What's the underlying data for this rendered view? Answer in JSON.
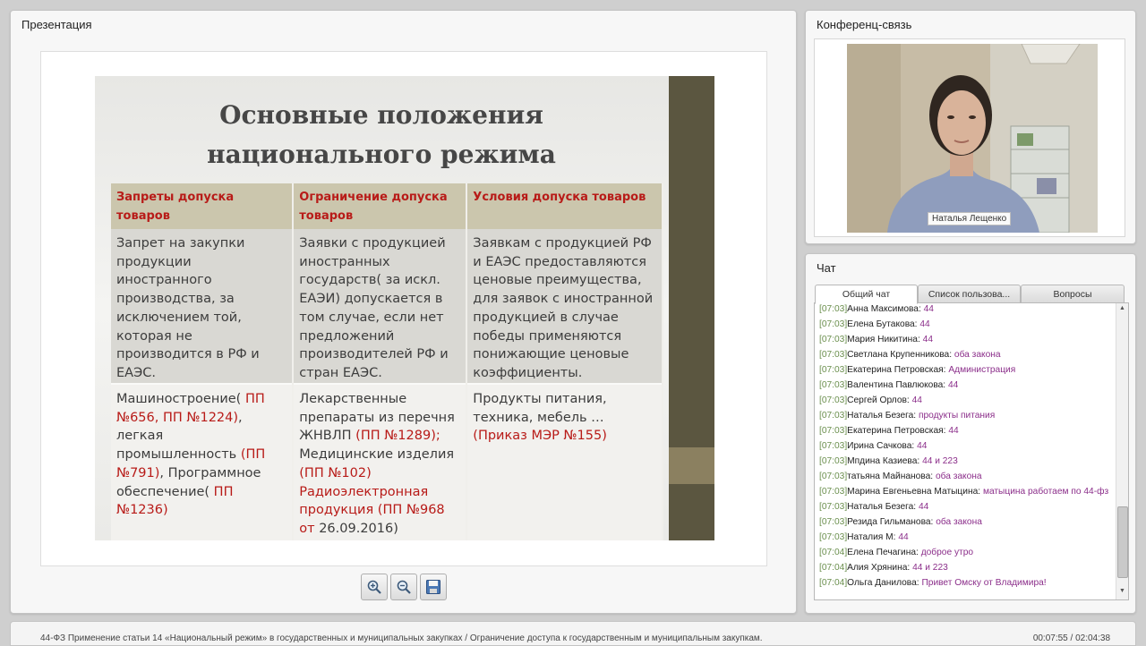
{
  "presentation": {
    "panel_title": "Презентация",
    "slide": {
      "title_line1": "Основные положения",
      "title_line2": "национального режима",
      "headers": [
        "Запреты допуска товаров",
        "Ограничение допуска товаров",
        "Условия допуска товаров"
      ],
      "row1": [
        "Запрет на закупки продукции иностранного производства, за исключением той, которая не производится в РФ и ЕАЭС.",
        "Заявки с продукцией иностранных государств( за искл. ЕАЭИ) допускается в том случае, если нет предложений производителей РФ и стран ЕАЭС.",
        "Заявкам с продукцией РФ и ЕАЭС предоставляются ценовые преимущества, для заявок с иностранной продукцией в случае победы применяются понижающие ценовые коэффициенты."
      ],
      "row2": {
        "c1_a": "Машиностроение(",
        "c1_b": " ПП №656, ПП №1224)",
        "c1_c": ", легкая промышленность ",
        "c1_d": "(ПП №791)",
        "c1_e": ", Программное обеспечение(",
        "c1_f": " ПП №1236)",
        "c2_a": "Лекарственные препараты из перечня ЖНВЛП ",
        "c2_b": "(ПП №1289);",
        "c2_c": " Медицинские изделия ",
        "c2_d": "(ПП №102) Радиоэлектронная продукция (ПП №968 от ",
        "c2_e": "26.09.2016)",
        "c3_a": "Продукты питания, техника, мебель … ",
        "c3_b": "(Приказ МЭР №155)"
      }
    },
    "tools": [
      "zoom-in",
      "zoom-out",
      "save"
    ]
  },
  "conference": {
    "panel_title": "Конференц-связь",
    "speaker_name": "Наталья Лещенко"
  },
  "chat": {
    "panel_title": "Чат",
    "tabs": [
      "Общий чат",
      "Список пользова...",
      "Вопросы"
    ],
    "messages": [
      {
        "time": "[07:03]",
        "name": "Анна Максимова:",
        "text": "44"
      },
      {
        "time": "[07:03]",
        "name": "Елена Бутакова:",
        "text": "44"
      },
      {
        "time": "[07:03]",
        "name": "Мария Никитина:",
        "text": "44"
      },
      {
        "time": "[07:03]",
        "name": "Светлана Крупенникова:",
        "text": "оба закона"
      },
      {
        "time": "[07:03]",
        "name": "Екатерина Петровская:",
        "text": "Администрация"
      },
      {
        "time": "[07:03]",
        "name": "Валентина Павлюкова:",
        "text": "44"
      },
      {
        "time": "[07:03]",
        "name": "Сергей Орлов:",
        "text": "44"
      },
      {
        "time": "[07:03]",
        "name": "Наталья Безега:",
        "text": "продукты питания"
      },
      {
        "time": "[07:03]",
        "name": "Екатерина Петровская:",
        "text": "44"
      },
      {
        "time": "[07:03]",
        "name": "Ирина Сачкова:",
        "text": "44"
      },
      {
        "time": "[07:03]",
        "name": "Мпдина Казиева:",
        "text": "44 и 223"
      },
      {
        "time": "[07:03]",
        "name": "татьяна Майнанова:",
        "text": "оба закона"
      },
      {
        "time": "[07:03]",
        "name": "Марина Евгеньевна Матыцина:",
        "text": "матыцина работаем по 44-фз"
      },
      {
        "time": "[07:03]",
        "name": "Наталья Безега:",
        "text": "44"
      },
      {
        "time": "[07:03]",
        "name": "Резида Гильманова:",
        "text": "оба закона"
      },
      {
        "time": "[07:03]",
        "name": "Наталия М:",
        "text": "44"
      },
      {
        "time": "[07:04]",
        "name": "Елена Печагина:",
        "text": "доброе утро"
      },
      {
        "time": "[07:04]",
        "name": "Алия Хрянина:",
        "text": "44 и 223"
      },
      {
        "time": "[07:04]",
        "name": "Ольга Данилова:",
        "text": "Привет Омску от Владимира!"
      }
    ]
  },
  "footer": {
    "title": "44-ФЗ Применение статьи 14 «Национальный режим» в государственных и муниципальных закупках / Ограничение доступа к государственным и муниципальным закупкам.",
    "time": "00:07:55 / 02:04:38"
  },
  "colors": {
    "slide_header_red": "#b81b18",
    "slide_bar": "#5b5640",
    "chat_timestamp": "#6b8f4e",
    "chat_text": "#8b2e8a"
  }
}
